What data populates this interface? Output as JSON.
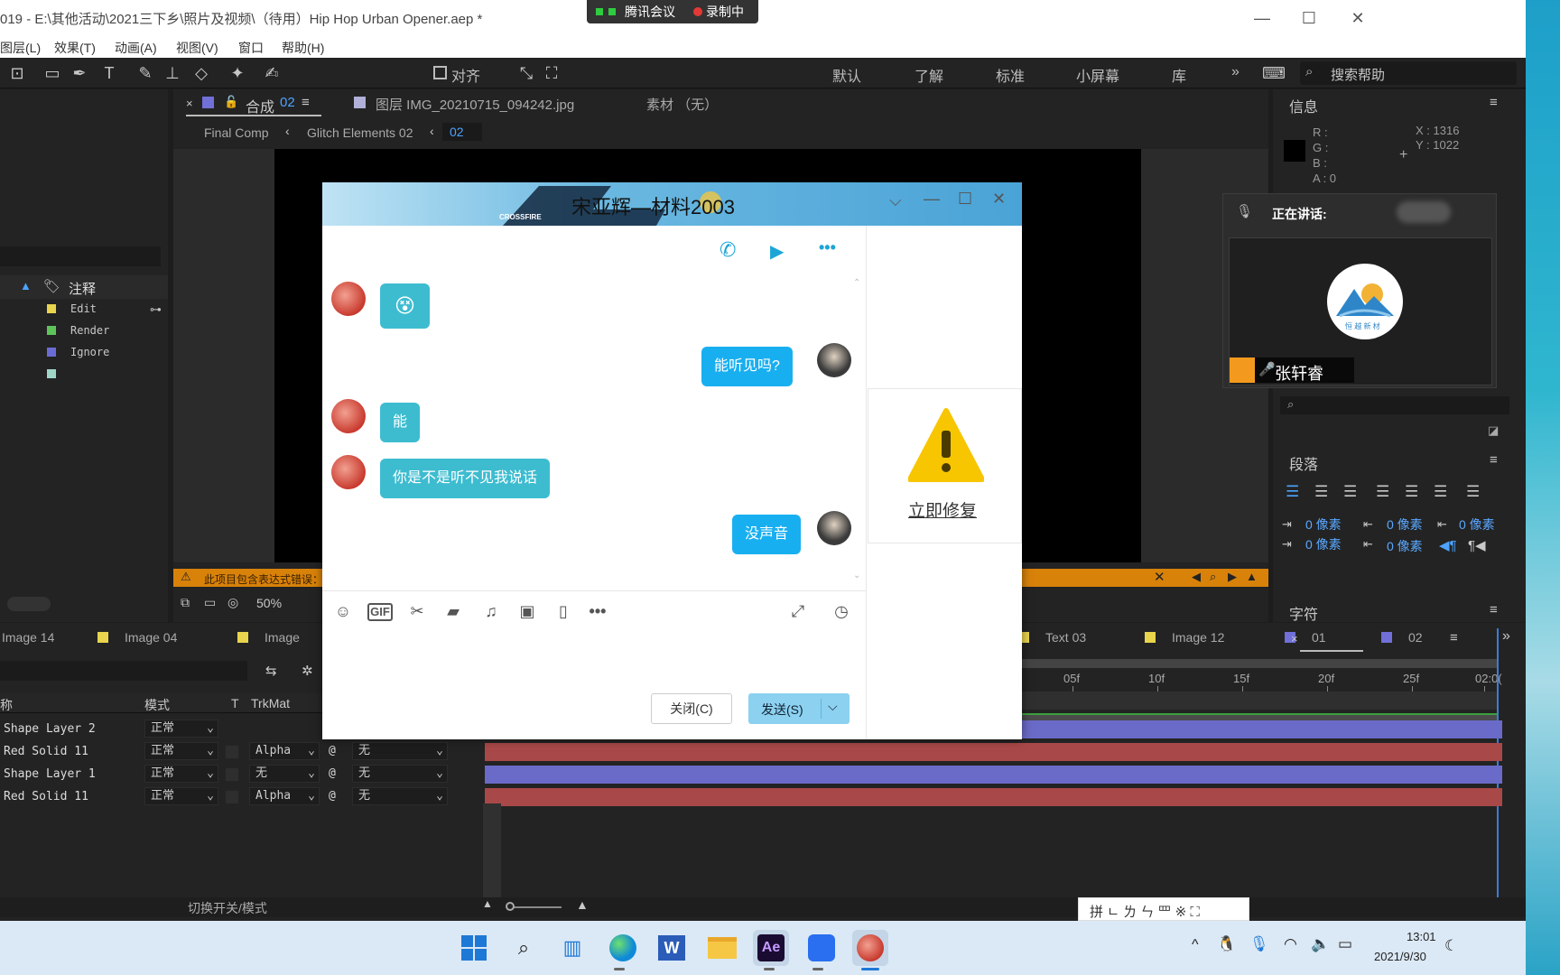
{
  "window": {
    "title": "019 - E:\\其他活动\\2021三下乡\\照片及视频\\（待用）Hip Hop Urban Opener.aep *",
    "minimize": "—",
    "maximize": "☐",
    "close": "✕"
  },
  "meeting_bar": {
    "app": "腾讯会议",
    "recording": "录制中"
  },
  "menu": [
    "图层(L)",
    "效果(T)",
    "动画(A)",
    "视图(V)",
    "窗口",
    "帮助(H)"
  ],
  "toolbar": {
    "align_label": "对齐",
    "workspaces": [
      "默认",
      "了解",
      "标准",
      "小屏幕",
      "库"
    ],
    "more": "»",
    "search_placeholder": "搜索帮助"
  },
  "comp_panel": {
    "tab_label": "合成",
    "tab_number": "02",
    "layer_tab": "图层 IMG_20210715_094242.jpg",
    "footage_tab": "素材 （无）",
    "breadcrumbs": [
      "Final Comp",
      "Glitch Elements 02",
      "02"
    ],
    "zoom": "50%",
    "warning": "此项目包含表达式错误："
  },
  "project_panel": {
    "section": "注释",
    "labels": [
      {
        "name": "Edit",
        "color": "#e8d44d"
      },
      {
        "name": "Render",
        "color": "#5ec45a"
      },
      {
        "name": "Ignore",
        "color": "#6b6bd6"
      },
      {
        "name": "",
        "color": "#9fd6c8"
      }
    ]
  },
  "info_panel": {
    "title": "信息",
    "r": "R :",
    "g": "G :",
    "b": "B :",
    "a": "A : 0",
    "x": "X : 1316",
    "y": "Y : 1022"
  },
  "speaking": {
    "label": "正在讲话:",
    "name": "张轩睿",
    "logo_text": "恒 越 新 材"
  },
  "paragraph_panel": {
    "title": "段落",
    "indent_values": [
      "0 像素",
      "0 像素",
      "0 像素",
      "0 像素",
      "0 像素"
    ]
  },
  "char_panel": {
    "title": "字符"
  },
  "timeline": {
    "tabs": [
      "Image 14",
      "Image 04",
      "Image",
      "Text 03",
      "Image 12",
      "01",
      "02"
    ],
    "tab_colors": [
      "#e8d44d",
      "#e8d44d",
      "#e8d44d",
      "#e8d44d",
      "#e8d44d",
      "#7070d8",
      "#7070d8"
    ],
    "col_name": "称",
    "col_mode": "模式",
    "col_t": "T",
    "col_trkmat": "TrkMat",
    "ruler": [
      "05f",
      "10f",
      "15f",
      "20f",
      "25f",
      "02:0("
    ],
    "layers": [
      {
        "name": "Shape Layer 2",
        "mode": "正常",
        "trkmat": "",
        "parent": "",
        "color": "#6a6ac8"
      },
      {
        "name": "Red Solid 11",
        "mode": "正常",
        "trkmat": "Alpha",
        "parent": "无",
        "color": "#a94848"
      },
      {
        "name": "Shape Layer 1",
        "mode": "正常",
        "trkmat": "无",
        "parent": "无",
        "color": "#6a6ac8"
      },
      {
        "name": "Red Solid 11",
        "mode": "正常",
        "trkmat": "Alpha",
        "parent": "无",
        "color": "#a94848"
      }
    ],
    "footer": "切换开关/模式"
  },
  "chat": {
    "title": "宋亚辉—材料2003",
    "banner_text": "CROSSFIRE",
    "messages": [
      {
        "side": "left",
        "text": "😵"
      },
      {
        "side": "right",
        "text": "能听见吗?"
      },
      {
        "side": "left",
        "text": "能"
      },
      {
        "side": "left",
        "text": "你是不是听不见我说话"
      },
      {
        "side": "right",
        "text": "没声音"
      }
    ],
    "tools_more": "•••",
    "close_button": "关闭(C)",
    "send_button": "发送(S)",
    "repair_link": "立即修复",
    "gif_label": "GIF"
  },
  "ime": {
    "text": "拼 ㄴ ㄌ ㄣ 罒 ※ ⛶"
  },
  "taskbar": {
    "time": "13:01",
    "date": "2021/9/30",
    "apps": [
      "windows-start",
      "search",
      "widgets",
      "edge",
      "word",
      "explorer",
      "after-effects",
      "tencent-meeting",
      "qq-chat"
    ]
  }
}
